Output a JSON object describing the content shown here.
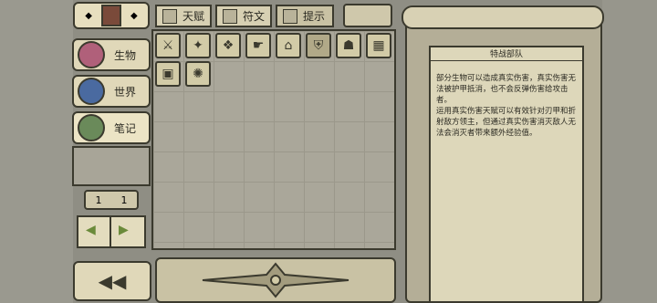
{
  "tabs": [
    {
      "label": "天赋"
    },
    {
      "label": "符文"
    },
    {
      "label": "提示"
    }
  ],
  "sidebar": {
    "items": [
      {
        "label": "生物",
        "icon": "creature-icon"
      },
      {
        "label": "世界",
        "icon": "world-icon"
      },
      {
        "label": "笔记",
        "icon": "notes-icon"
      }
    ]
  },
  "pager": {
    "left": "1",
    "right": "1"
  },
  "grid": {
    "row1": [
      "talent-icon-1",
      "talent-icon-2",
      "talent-icon-3",
      "talent-icon-4",
      "talent-icon-5",
      "talent-icon-6",
      "talent-icon-7",
      "talent-icon-8"
    ],
    "row2": [
      "talent-icon-9",
      "talent-icon-10"
    ]
  },
  "document": {
    "title": "特战部队",
    "body": "部分生物可以造成真实伤害，真实伤害无法被护甲抵消，也不会反弹伤害给攻击者。\n运用真实伤害天赋可以有效针对刃甲和折射敌方领主，但通过真实伤害消灭敌人无法会消灭者带来额外经验值。"
  },
  "colors": {
    "ink": "#3b3a2e",
    "paper": "#ddd7ba"
  }
}
